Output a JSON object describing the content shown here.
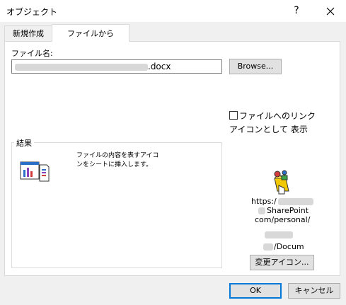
{
  "window": {
    "title": "オブジェクト",
    "help": "?",
    "close": "✕"
  },
  "tabs": [
    {
      "label": "新規作成"
    },
    {
      "label": "ファイルから"
    }
  ],
  "file": {
    "name_label": "ファイル名:",
    "name_value": ".docx",
    "browse_label": "Browse..."
  },
  "link_checkbox": {
    "label": "ファイルへのリンク",
    "checked": false
  },
  "icon_checkbox": {
    "label": "アイコンとして 表示",
    "checked": true
  },
  "result": {
    "label": "結果",
    "description": "ファイルの内容を表すアイコンをシートに挿入します。"
  },
  "icon_caption": {
    "line1": "https:/",
    "line2": "SharePoint",
    "line3": "com/personal/",
    "line4": "/Docum"
  },
  "buttons": {
    "change_icon": "変更アイコン...",
    "ok": "OK",
    "cancel": "キャンセル"
  }
}
